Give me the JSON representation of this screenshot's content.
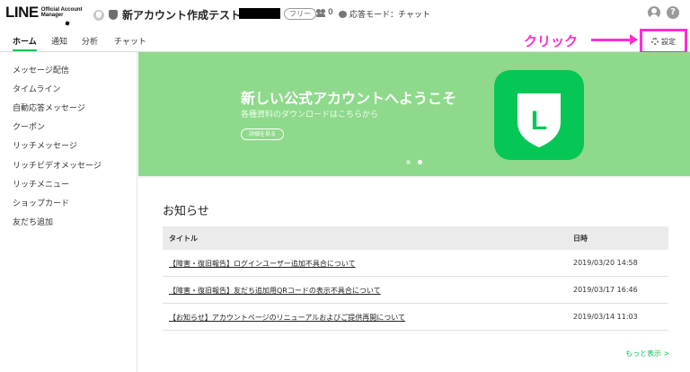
{
  "header": {
    "logo_main": "LINE",
    "logo_sub": "Official Account Manager",
    "account_name": "新アカウント作成テスト",
    "plan_badge": "フリー",
    "friend_count": "0",
    "response_mode": "応答モード：チャット"
  },
  "tabs": [
    {
      "label": "ホーム",
      "active": true
    },
    {
      "label": "通知",
      "active": false
    },
    {
      "label": "分析",
      "active": false
    },
    {
      "label": "チャット",
      "active": false
    }
  ],
  "annotation": {
    "text": "クリック",
    "color": "#ff2ed1"
  },
  "settings_label": "設定",
  "sidebar": {
    "items": [
      {
        "label": "メッセージ配信"
      },
      {
        "label": "タイムライン"
      },
      {
        "label": "自動応答メッセージ"
      },
      {
        "label": "クーポン"
      },
      {
        "label": "リッチメッセージ"
      },
      {
        "label": "リッチビデオメッセージ"
      },
      {
        "label": "リッチメニュー"
      },
      {
        "label": "ショップカード"
      },
      {
        "label": "友だち追加"
      }
    ]
  },
  "banner": {
    "title": "新しい公式アカウントへようこそ",
    "subtitle": "各種資料のダウンロードはこちらから",
    "button_label": "詳細を見る",
    "logo_letter": "L",
    "slide_count": 2,
    "active_slide": 2
  },
  "news": {
    "heading": "お知らせ",
    "col_title": "タイトル",
    "col_date": "日時",
    "rows": [
      {
        "title": "【障害・復旧報告】ログインユーザー追加不具合について",
        "date": "2019/03/20 14:58"
      },
      {
        "title": "【障害・復旧報告】友だち追加用QRコードの表示不具合について",
        "date": "2019/03/17 16:46"
      },
      {
        "title": "【お知らせ】アカウントページのリニューアルおよびご提供再開について",
        "date": "2019/03/14 11:03"
      }
    ],
    "more_link": "もっと表示 >"
  },
  "colors": {
    "brand_green": "#06c755",
    "banner_green": "#8fd98c",
    "annotation_pink": "#ff2ed1"
  },
  "icons": [
    "account-avatar-icon",
    "shield-icon",
    "caret-down-icon",
    "friends-icon",
    "chat-bubble-icon",
    "user-icon",
    "help-icon",
    "gear-icon",
    "line-logo-icon"
  ]
}
